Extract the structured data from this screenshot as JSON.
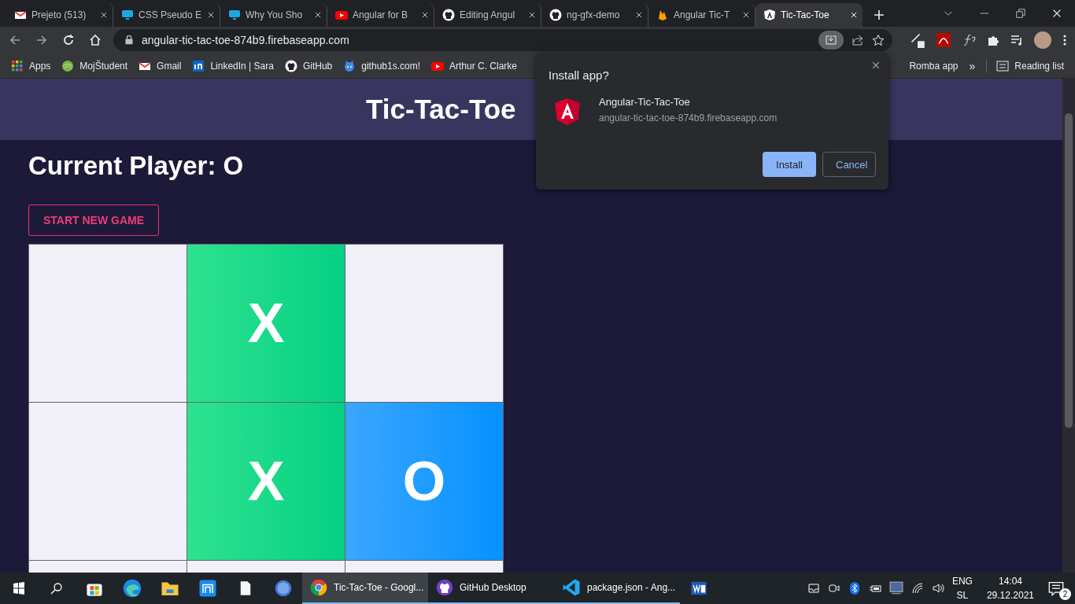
{
  "tabs": [
    {
      "kind": "mail",
      "title": "Prejeto (513)",
      "selected": false
    },
    {
      "kind": "monitor",
      "title": "CSS Pseudo E",
      "selected": false
    },
    {
      "kind": "monitor",
      "title": "Why You Sho",
      "selected": false
    },
    {
      "kind": "video",
      "title": "Angular for B",
      "selected": false
    },
    {
      "kind": "cat",
      "title": "Editing Angul",
      "selected": false
    },
    {
      "kind": "cat",
      "title": "ng-gfx-demo",
      "selected": false
    },
    {
      "kind": "flame",
      "title": "Angular Tic-T",
      "selected": false
    },
    {
      "kind": "shield",
      "title": "Tic-Tac-Toe",
      "selected": true
    }
  ],
  "address": "angular-tic-tac-toe-874b9.firebaseapp.com",
  "bookmarks": [
    {
      "kind": "grid",
      "label": "Apps"
    },
    {
      "kind": "ball",
      "label": "MojŠtudent"
    },
    {
      "kind": "mail",
      "label": "Gmail"
    },
    {
      "kind": "in",
      "label": "LinkedIn | Sara"
    },
    {
      "kind": "cat",
      "label": "GitHub"
    },
    {
      "kind": "octo",
      "label": "github1s.com!"
    },
    {
      "kind": "video",
      "label": "Arthur C. Clarke"
    }
  ],
  "bookmarks_right": {
    "item": "Romba app",
    "more": "»",
    "reading": "Reading list"
  },
  "page": {
    "header": "Tic-Tac-Toe",
    "current_player": "Current Player: O",
    "new_game": "START NEW GAME",
    "cells": [
      {
        "kind": "empty"
      },
      {
        "kind": "x",
        "text": "X"
      },
      {
        "kind": "empty"
      },
      {
        "kind": "empty"
      },
      {
        "kind": "x",
        "text": "X"
      },
      {
        "kind": "o",
        "text": "O"
      },
      {
        "kind": "empty"
      },
      {
        "kind": "empty"
      },
      {
        "kind": "empty"
      }
    ]
  },
  "install_dialog": {
    "title": "Install app?",
    "app_name": "Angular-Tic-Tac-Toe",
    "app_url": "angular-tic-tac-toe-874b9.firebaseapp.com",
    "install": "Install",
    "cancel": "Cancel"
  },
  "taskbar": {
    "apps": [
      {
        "kind": "chrome",
        "label": "Tic-Tac-Toe - Googl...",
        "selected": true
      },
      {
        "kind": "cat",
        "label": "GitHub Desktop",
        "selected": false
      },
      {
        "kind": "code",
        "label": "package.json - Ang...",
        "selected": false
      }
    ],
    "lang": "ENG",
    "layout": "SL",
    "time": "14:04",
    "date": "29.12.2021",
    "notifications": "2"
  }
}
